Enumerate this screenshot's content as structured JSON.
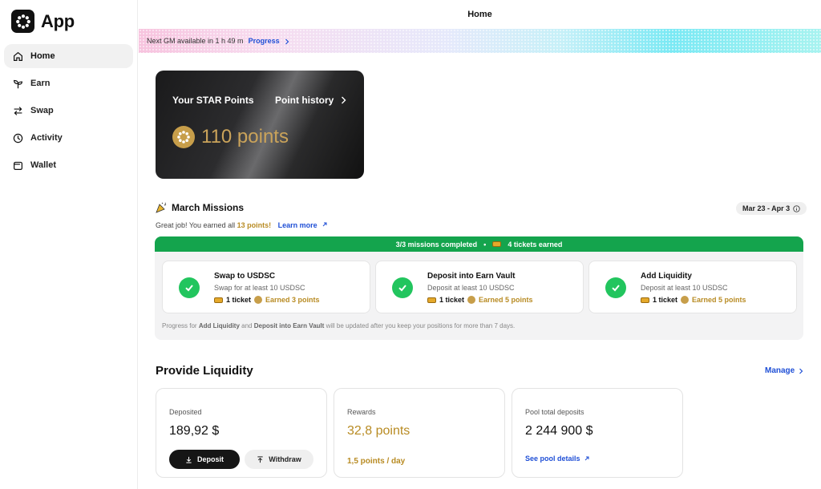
{
  "app": {
    "name": "App"
  },
  "sidebar": {
    "items": [
      {
        "label": "Home",
        "icon": "home-icon",
        "active": true
      },
      {
        "label": "Earn",
        "icon": "sprout-icon"
      },
      {
        "label": "Swap",
        "icon": "swap-arrows-icon"
      },
      {
        "label": "Activity",
        "icon": "clock-icon"
      },
      {
        "label": "Wallet",
        "icon": "wallet-icon"
      }
    ]
  },
  "header": {
    "title": "Home"
  },
  "banner": {
    "text": "Next GM available in 1 h 49 m",
    "link": "Progress"
  },
  "points_card": {
    "title": "Your STAR Points",
    "history_label": "Point history",
    "points": "110 points"
  },
  "missions": {
    "title": "March Missions",
    "date_range": "Mar 23 - Apr 3",
    "subtitle_prefix": "Great job! You earned all",
    "subtitle_points": "13 points!",
    "learn_more": "Learn more",
    "status_completed": "3/3 missions completed",
    "status_separator": "•",
    "status_tickets": "4 tickets earned",
    "items": [
      {
        "name": "Swap to USDSC",
        "desc": "Swap for at least 10 USDSC",
        "ticket": "1 ticket",
        "earned": "Earned 3 points"
      },
      {
        "name": "Deposit into Earn Vault",
        "desc": "Deposit at least 10 USDSC",
        "ticket": "1 ticket",
        "earned": "Earned 5 points"
      },
      {
        "name": "Add Liquidity",
        "desc": "Deposit at least 10 USDSC",
        "ticket": "1 ticket",
        "earned": "Earned 5 points"
      }
    ],
    "note": {
      "part1": "Progress for",
      "bold1": "Add Liquidity",
      "part2": "and",
      "bold2": "Deposit into Earn Vault",
      "part3": "will be updated after you keep your positions for more than 7 days."
    }
  },
  "liquidity": {
    "title": "Provide Liquidity",
    "manage": "Manage",
    "deposited": {
      "label": "Deposited",
      "value": "189,92 $",
      "deposit_btn": "Deposit",
      "withdraw_btn": "Withdraw"
    },
    "rewards": {
      "label": "Rewards",
      "value": "32,8 points",
      "rate": "1,5 points / day"
    },
    "pool": {
      "label": "Pool total deposits",
      "value": "2 244 900 $",
      "link": "See pool details"
    }
  },
  "colors": {
    "accent": "#1f4fd6",
    "gold": "#b88b23",
    "success": "#14a44d",
    "check": "#22c55e"
  }
}
